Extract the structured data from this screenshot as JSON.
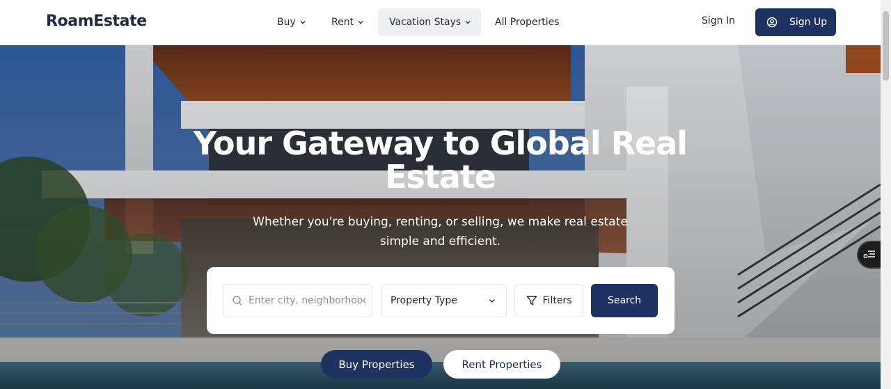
{
  "brand": {
    "name": "RoamEstate"
  },
  "nav": {
    "buy": "Buy",
    "rent": "Rent",
    "vacation": "Vacation Stays",
    "all": "All Properties"
  },
  "auth": {
    "sign_in": "Sign In",
    "sign_up": "Sign Up"
  },
  "hero": {
    "title_line1": "Your Gateway to Global Real",
    "title_line2": "Estate",
    "subtitle": "Whether you're buying, renting, or selling, we make real estate simple and efficient."
  },
  "search": {
    "placeholder": "Enter city, neighborhood",
    "property_type": "Property Type",
    "filters": "Filters",
    "button": "Search"
  },
  "pills": {
    "buy": "Buy Properties",
    "rent": "Rent Properties"
  },
  "icons": {
    "search": "search-icon",
    "chevron": "chevron-down-icon",
    "filter": "filter-icon",
    "user": "user-circle-icon",
    "widget": "accessibility-menu-icon"
  },
  "colors": {
    "primary": "#1e3361",
    "nav_active_bg": "#eef0f4"
  }
}
